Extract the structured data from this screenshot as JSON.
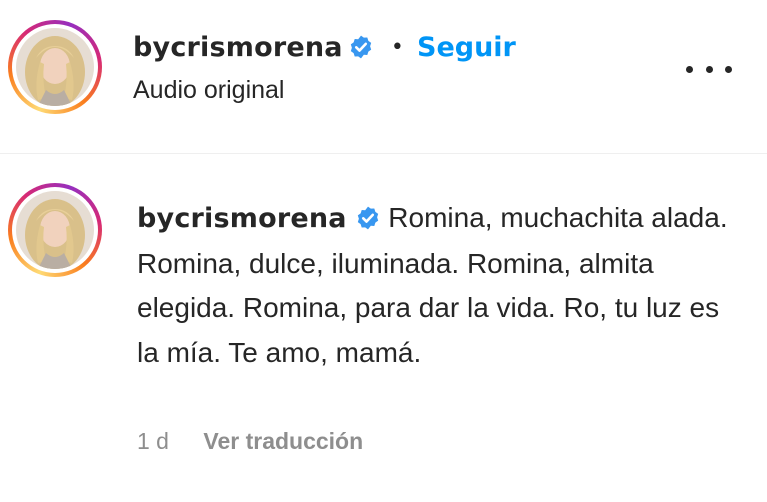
{
  "header": {
    "username": "bycrismorena",
    "separator": "•",
    "follow_label": "Seguir",
    "audio_label": "Audio original",
    "verified_icon": "verified-badge-icon",
    "more_icon": "more-options-icon"
  },
  "comment": {
    "username": "bycrismorena",
    "text": "Romina, muchachita alada. Romina, dulce, iluminada. Romina, almita elegida. Romina, para dar la vida. Ro, tu luz es la mía. Te amo, mamá.",
    "time": "1 d",
    "translate_label": "Ver traducción"
  },
  "colors": {
    "accent": "#0095f6",
    "verified": "#3897f0",
    "muted": "#8e8e8e",
    "text": "#262626"
  }
}
